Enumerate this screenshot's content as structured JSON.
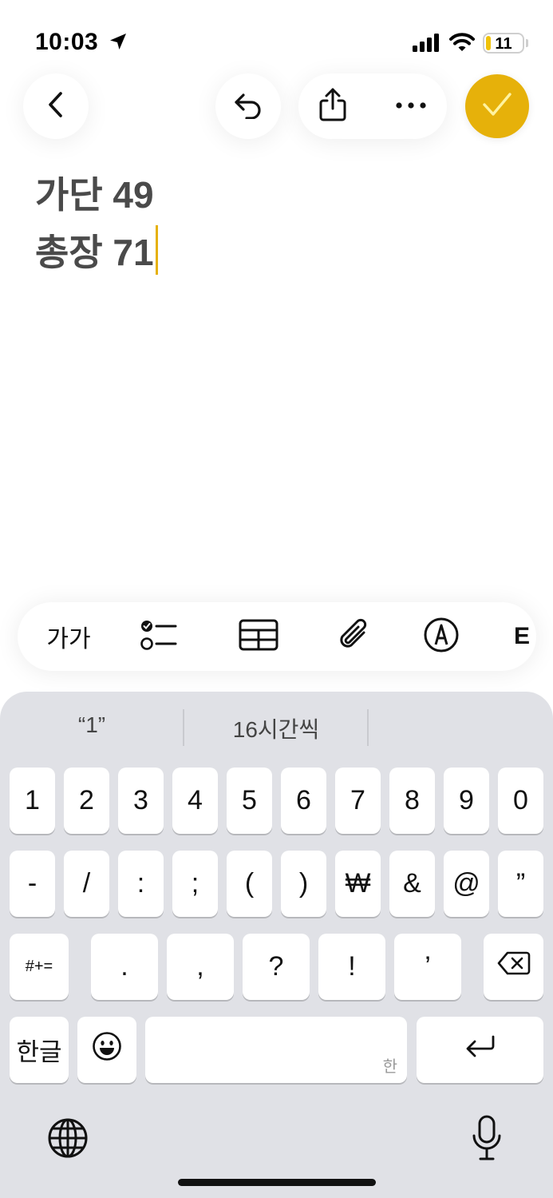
{
  "status_bar": {
    "time": "10:03",
    "battery": "11"
  },
  "toolbar": {
    "back_icon": "chevron-left-icon",
    "undo_icon": "undo-icon",
    "share_icon": "share-icon",
    "more_icon": "ellipsis-icon",
    "done_icon": "checkmark-icon",
    "accent": "#e6b10a"
  },
  "note": {
    "lines": [
      "가단 49",
      "총장 71"
    ]
  },
  "format_bar": {
    "text_style": "가가",
    "items": [
      "checklist-icon",
      "table-icon",
      "paperclip-icon",
      "markup-icon"
    ],
    "overflow_partial": "E"
  },
  "keyboard": {
    "suggestions": [
      "“1”",
      "16시간씩"
    ],
    "row1": [
      "1",
      "2",
      "3",
      "4",
      "5",
      "6",
      "7",
      "8",
      "9",
      "0"
    ],
    "row2": [
      "-",
      "/",
      ":",
      ";",
      "(",
      ")",
      "₩",
      "&",
      "@",
      "”"
    ],
    "row3": [
      ".",
      ",",
      "?",
      "!",
      "’"
    ],
    "symbols_key": "#+=",
    "lang_key": "한글",
    "space_hint": "한",
    "emoji_icon": "emoji-icon",
    "return_icon": "return-icon",
    "delete_icon": "delete-icon",
    "globe_icon": "globe-icon",
    "mic_icon": "microphone-icon"
  }
}
